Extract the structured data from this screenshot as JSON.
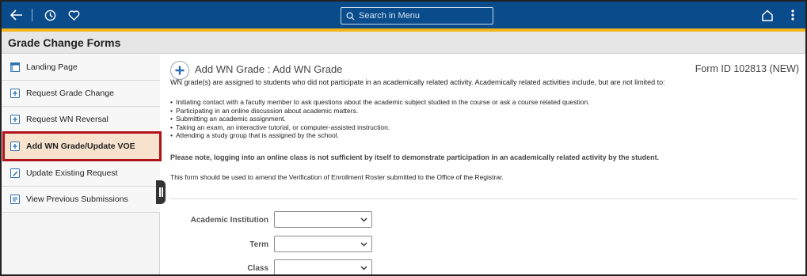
{
  "header": {
    "search_placeholder": "Search in Menu"
  },
  "page_title": "Grade Change Forms",
  "sidebar": {
    "items": [
      {
        "label": "Landing Page"
      },
      {
        "label": "Request Grade Change"
      },
      {
        "label": "Request WN Reversal"
      },
      {
        "label": "Add WN Grade/Update VOE"
      },
      {
        "label": "Update Existing Request"
      },
      {
        "label": "View Previous Submissions"
      }
    ],
    "active_color": "#b2121b"
  },
  "main": {
    "heading": "Add WN Grade : Add WN Grade",
    "form_id": "Form ID 102813 (NEW)",
    "intro": "WN grade(s) are assigned to students who did not participate in an academically related activity.  Academically related activities include, but are not limited to:",
    "bullets": [
      "Initiating contact with a faculty member to ask questions about the academic subject studied in the course or ask a course related question.",
      "Participating in an online discussion about academic matters.",
      "Submitting an academic assignment.",
      "Taking an exam, an interactive tutorial, or computer-assisted instruction.",
      "Attending a study group that is assigned by the school."
    ],
    "note": "Please note, logging into an online class is not sufficient by itself to demonstrate participation in an academically related activity by the student.",
    "amend": "This form should be used to amend the Verification of Enrollment Roster submitted to the Office of the Registrar.",
    "fields": [
      {
        "label": "Academic Institution",
        "value": ""
      },
      {
        "label": "Term",
        "value": ""
      },
      {
        "label": "Class",
        "value": ""
      }
    ]
  },
  "colors": {
    "banner": "#0a4b8c",
    "accent": "#f2b51a"
  }
}
